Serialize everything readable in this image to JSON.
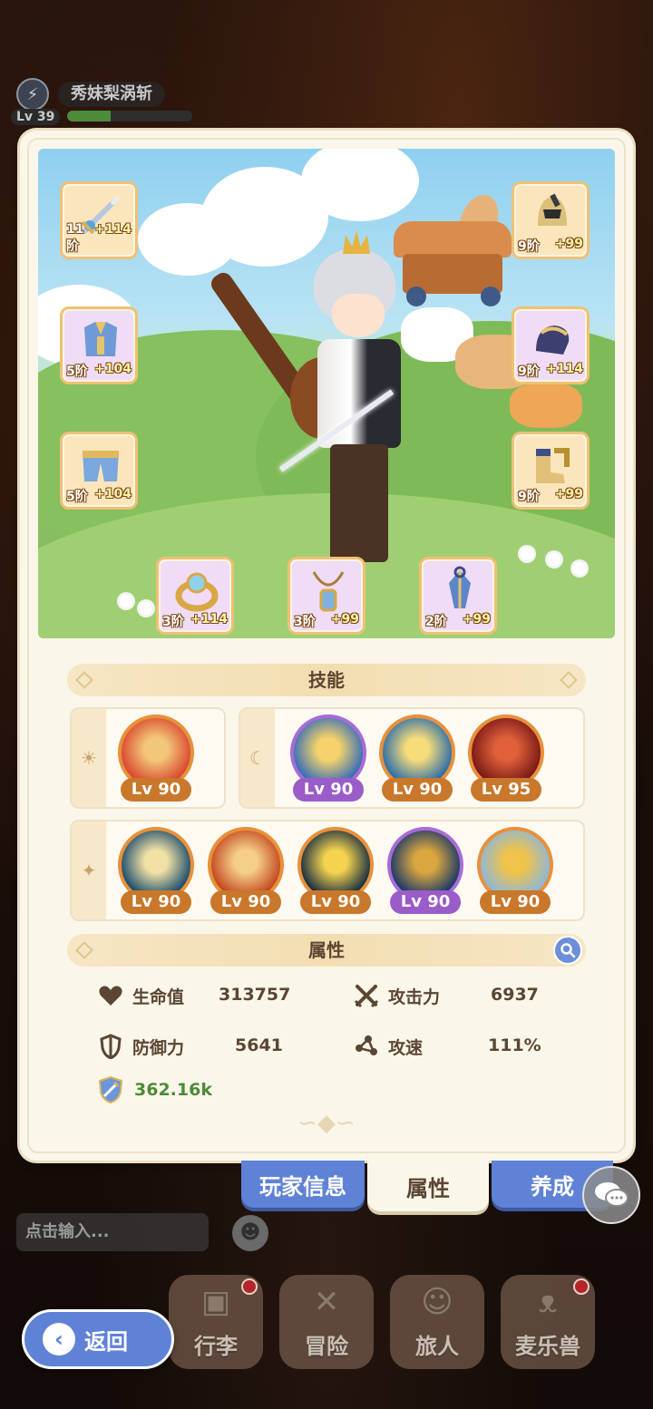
{
  "player": {
    "name": "秀妹梨涡斩",
    "level": "Lv 39",
    "xp_fraction": 0.35
  },
  "equipment": [
    {
      "id": "weapon",
      "tier": "11阶",
      "bonus": "+114",
      "icon": "sword-icon",
      "rarity": "orange"
    },
    {
      "id": "armor",
      "tier": "5阶",
      "bonus": "+104",
      "icon": "chest-armor-icon",
      "rarity": "purple"
    },
    {
      "id": "pants",
      "tier": "5阶",
      "bonus": "+104",
      "icon": "leg-armor-icon",
      "rarity": "orange"
    },
    {
      "id": "helmet",
      "tier": "9阶",
      "bonus": "+99",
      "icon": "helmet-icon",
      "rarity": "orange"
    },
    {
      "id": "gloves",
      "tier": "9阶",
      "bonus": "+114",
      "icon": "gauntlet-icon",
      "rarity": "purple"
    },
    {
      "id": "boots",
      "tier": "9阶",
      "bonus": "+99",
      "icon": "boots-icon",
      "rarity": "orange"
    },
    {
      "id": "ring",
      "tier": "3阶",
      "bonus": "+114",
      "icon": "ring-icon",
      "rarity": "purple"
    },
    {
      "id": "necklace",
      "tier": "3阶",
      "bonus": "+99",
      "icon": "necklace-icon",
      "rarity": "purple"
    },
    {
      "id": "charm",
      "tier": "2阶",
      "bonus": "+99",
      "icon": "charm-icon",
      "rarity": "purple"
    }
  ],
  "skills": {
    "header": "技能",
    "group_icons": [
      "sun-icon",
      "moon-icon",
      "star-icon"
    ],
    "sun_group": [
      {
        "level": "Lv 90",
        "icon": "winged-blade-skill-icon",
        "rarity": "orange",
        "colors": [
          "#d9492f",
          "#f3c77a"
        ]
      }
    ],
    "moon_group": [
      {
        "level": "Lv 90",
        "icon": "blue-warrior-skill-icon",
        "rarity": "purple",
        "colors": [
          "#3a6fb5",
          "#f5d36a"
        ]
      },
      {
        "level": "Lv 90",
        "icon": "golden-burst-skill-icon",
        "rarity": "orange",
        "colors": [
          "#2f6fa8",
          "#f7dc7a"
        ]
      },
      {
        "level": "Lv 95",
        "icon": "vortex-skill-icon",
        "rarity": "orange",
        "colors": [
          "#7a1a16",
          "#e0603a"
        ]
      }
    ],
    "star_group": [
      {
        "level": "Lv 90",
        "icon": "cross-slash-skill-icon",
        "rarity": "orange",
        "colors": [
          "#1f4f6d",
          "#f2e1a6"
        ]
      },
      {
        "level": "Lv 90",
        "icon": "fire-feather-skill-icon",
        "rarity": "orange",
        "colors": [
          "#c44a20",
          "#f5cf8a"
        ]
      },
      {
        "level": "Lv 90",
        "icon": "crescent-skill-icon",
        "rarity": "orange",
        "colors": [
          "#1c3142",
          "#f4d34f"
        ]
      },
      {
        "level": "Lv 90",
        "icon": "eagle-eye-skill-icon",
        "rarity": "purple",
        "colors": [
          "#1e3b66",
          "#d9a640"
        ]
      },
      {
        "level": "Lv 90",
        "icon": "radiant-eye-skill-icon",
        "rarity": "orange",
        "colors": [
          "#8fb7d6",
          "#f0c34a"
        ]
      }
    ]
  },
  "attributes": {
    "header": "属性",
    "hp": {
      "label": "生命值",
      "value": "313757",
      "icon": "heart-icon"
    },
    "attack": {
      "label": "攻击力",
      "value": "6937",
      "icon": "crossed-swords-icon"
    },
    "defense": {
      "label": "防御力",
      "value": "5641",
      "icon": "shield-icon"
    },
    "attack_speed": {
      "label": "攻速",
      "value": "111%",
      "icon": "speed-nodes-icon"
    },
    "power": {
      "value": "362.16k",
      "icon": "combat-power-icon"
    }
  },
  "tabs": {
    "player_info": "玩家信息",
    "attributes": "属性",
    "cultivation": "养成"
  },
  "chat": {
    "placeholder": "点击输入..."
  },
  "nav": {
    "bag": "行李",
    "adventure": "冒险",
    "travelers": "旅人",
    "pets": "麦乐兽"
  },
  "back_label": "返回",
  "colors": {
    "panel": "#fbf6ea",
    "accent_blue": "#5f82d6",
    "orange_rarity": "#e8903a",
    "purple_rarity": "#a86bd8",
    "power_green": "#4d8a3a",
    "text_brown": "#5a4632"
  }
}
